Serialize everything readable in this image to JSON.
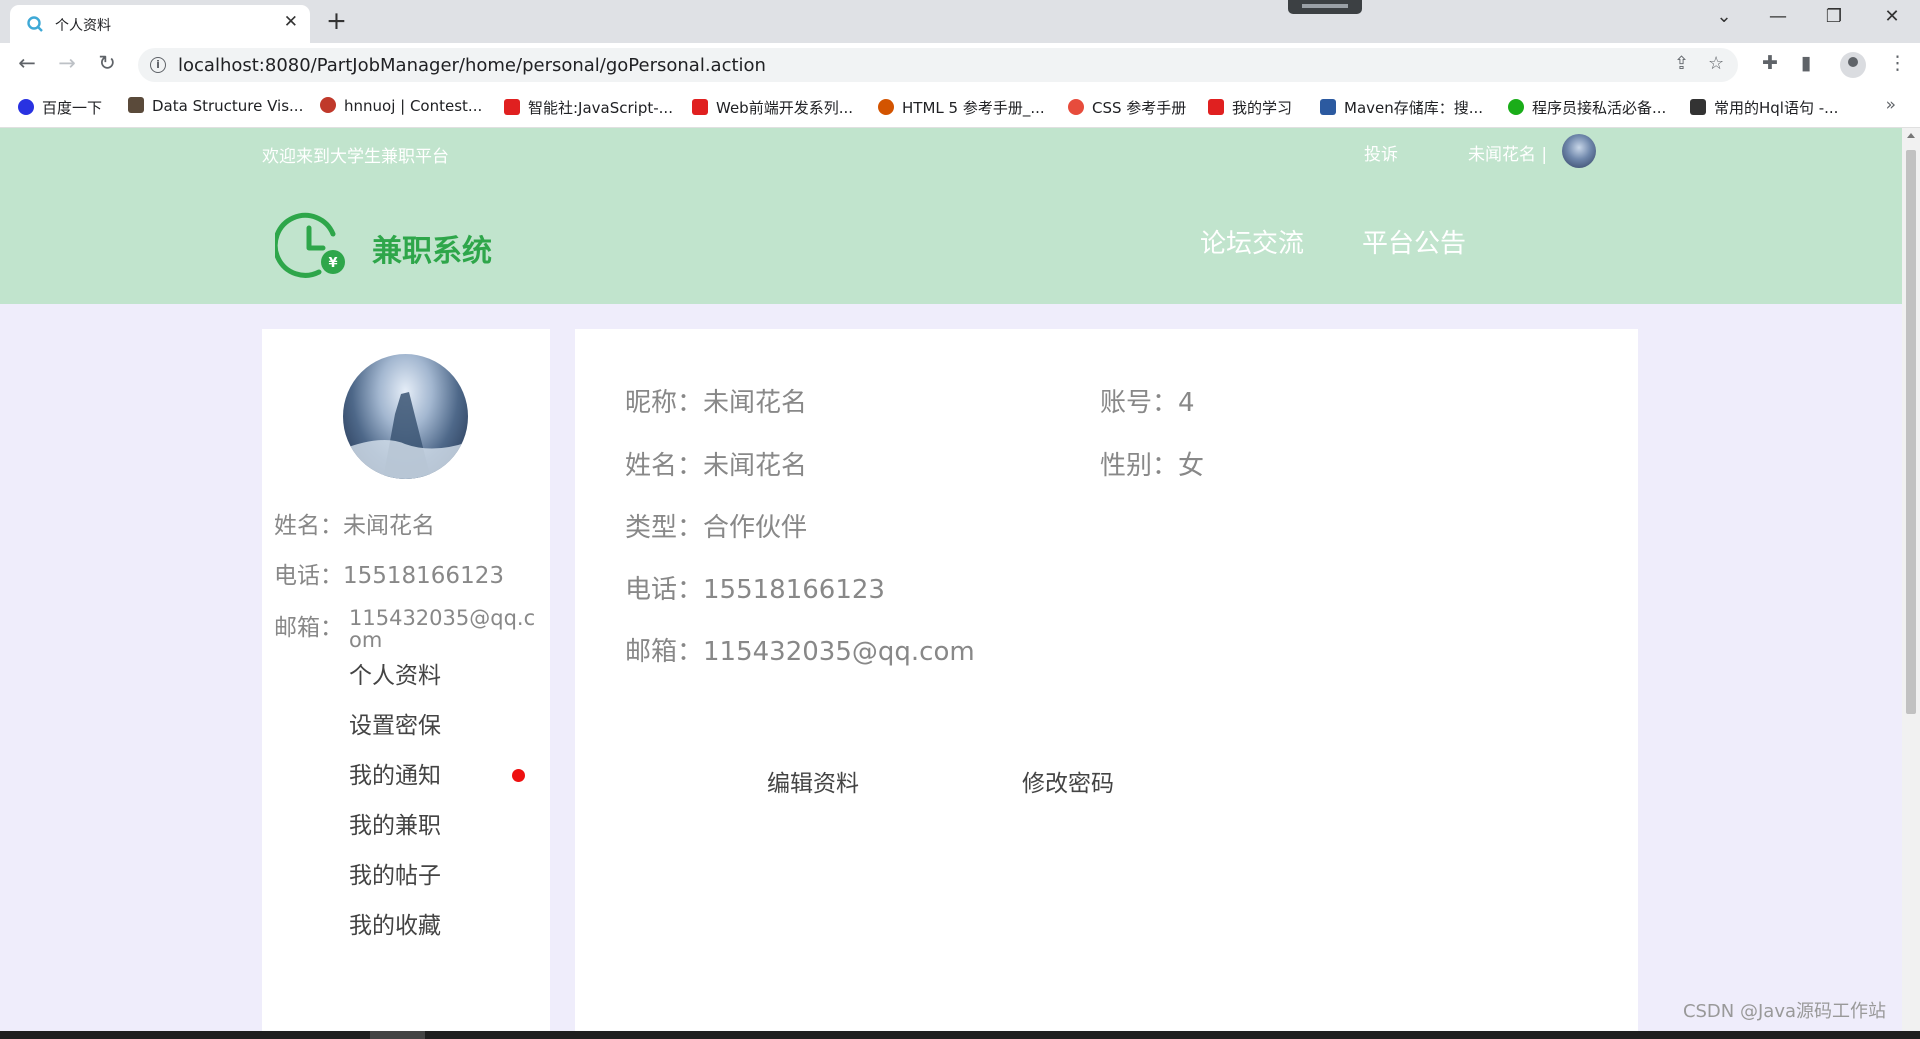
{
  "browser": {
    "tab_title": "个人资料",
    "url": "localhost:8080/PartJobManager/home/personal/goPersonal.action",
    "bookmarks": [
      {
        "label": "百度一下",
        "color": "#2932e1"
      },
      {
        "label": "Data Structure Vis...",
        "color": "#5a4a3a"
      },
      {
        "label": "hnnuoj | Contest...",
        "color": "#c0392b"
      },
      {
        "label": "智能社:JavaScript-...",
        "color": "#e02020"
      },
      {
        "label": "Web前端开发系列...",
        "color": "#e02020"
      },
      {
        "label": "HTML 5 参考手册_...",
        "color": "#d35400"
      },
      {
        "label": "CSS 参考手册",
        "color": "#e74c3c"
      },
      {
        "label": "我的学习",
        "color": "#e02020"
      },
      {
        "label": "Maven存储库：搜...",
        "color": "#2c5aa0"
      },
      {
        "label": "程序员接私活必备...",
        "color": "#1aad19"
      },
      {
        "label": "常用的Hql语句 -...",
        "color": "#333333"
      }
    ],
    "more": "»"
  },
  "header": {
    "welcome": "欢迎来到大学生兼职平台",
    "complain": "投诉",
    "username": "未闻花名 |",
    "brand": "兼职系统",
    "nav": [
      "论坛交流",
      "平台公告"
    ]
  },
  "sidebar": {
    "name_label": "姓名：",
    "name": "未闻花名",
    "phone_label": "电话：",
    "phone": "15518166123",
    "email_label": "邮箱：",
    "email": "115432035@qq.com",
    "menu": [
      "个人资料",
      "设置密保",
      "我的通知",
      "我的兼职",
      "我的帖子",
      "我的收藏"
    ]
  },
  "profile": {
    "nickname": "昵称：未闻花名",
    "account": "账号：4",
    "name": "姓名：未闻花名",
    "gender": "性别：女",
    "type": "类型：合作伙伴",
    "phone": "电话：15518166123",
    "email": "邮箱：115432035@qq.com",
    "edit_button": "编辑资料",
    "password_button": "修改密码"
  },
  "watermark": "CSDN @Java源码工作站",
  "colors": {
    "header_bg": "#c1e4cd",
    "brand_green": "#2ea64a",
    "page_bg": "#efedfb",
    "notification_dot": "#ee1111"
  }
}
